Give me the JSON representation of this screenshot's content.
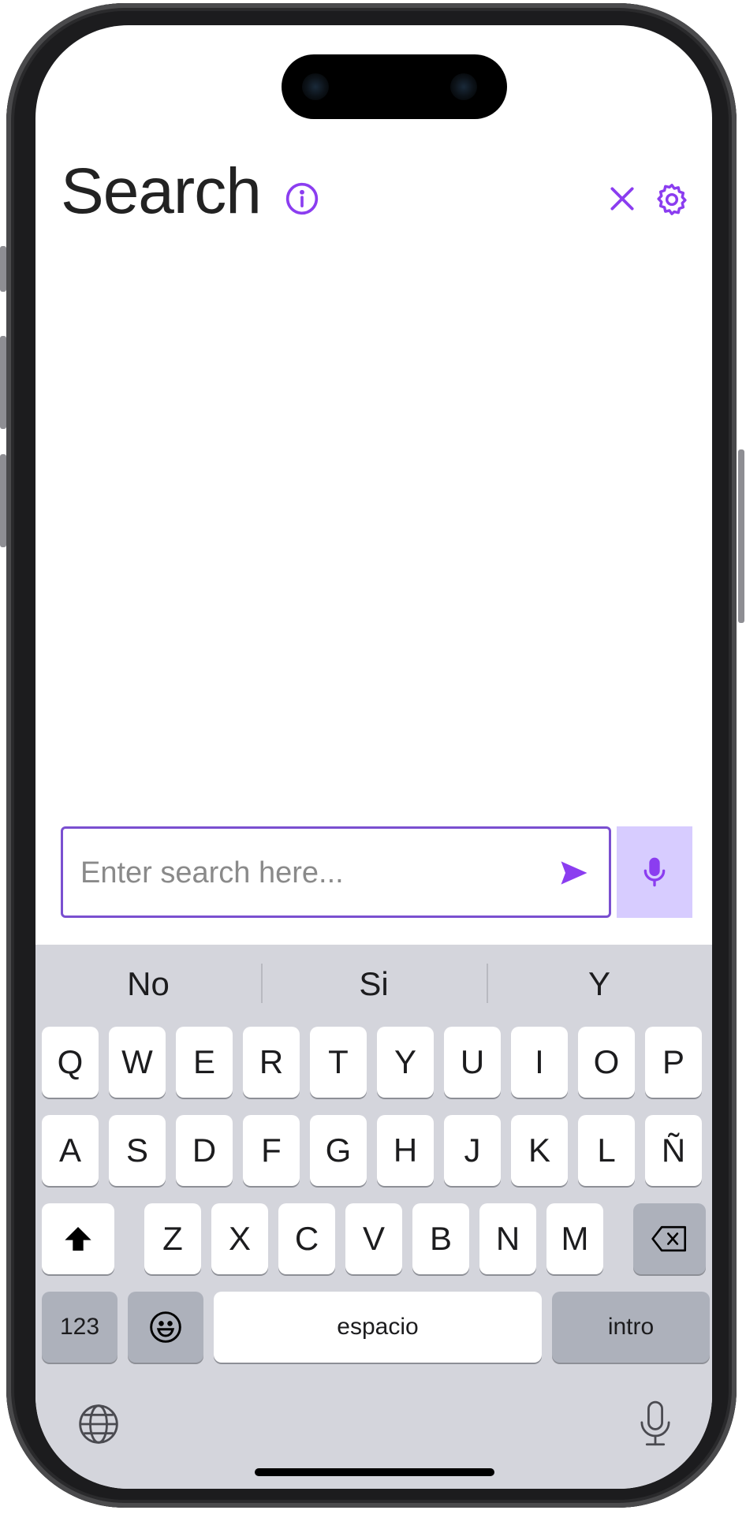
{
  "header": {
    "title": "Search"
  },
  "colors": {
    "accent": "#8b3df0",
    "mic_bg": "#d7ccff",
    "keyboard_bg": "#d4d5dc"
  },
  "search": {
    "placeholder": "Enter search here...",
    "value": ""
  },
  "keyboard": {
    "suggestions": [
      "No",
      "Si",
      "Y"
    ],
    "row1": [
      "Q",
      "W",
      "E",
      "R",
      "T",
      "Y",
      "U",
      "I",
      "O",
      "P"
    ],
    "row2": [
      "A",
      "S",
      "D",
      "F",
      "G",
      "H",
      "J",
      "K",
      "L",
      "Ñ"
    ],
    "row3": [
      "Z",
      "X",
      "C",
      "V",
      "B",
      "N",
      "M"
    ],
    "numbers_label": "123",
    "space_label": "espacio",
    "return_label": "intro"
  }
}
